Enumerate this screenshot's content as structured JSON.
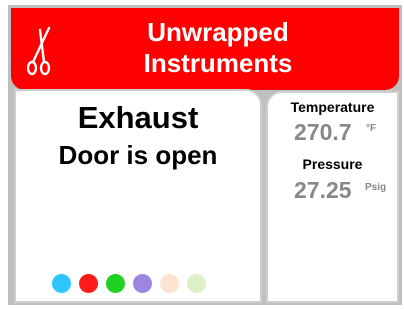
{
  "header": {
    "title_line1": "Unwrapped",
    "title_line2": "Instruments",
    "icon": "scissors-icon",
    "color": "#ff0000"
  },
  "status": {
    "line1": "Exhaust",
    "line2": "Door is open"
  },
  "indicators": [
    {
      "name": "cyan",
      "color": "#2ec4ff"
    },
    {
      "name": "red",
      "color": "#ff1a1a"
    },
    {
      "name": "green",
      "color": "#1fd21f"
    },
    {
      "name": "purple",
      "color": "#9d86df"
    },
    {
      "name": "peach",
      "color": "#fde3d2"
    },
    {
      "name": "light-green",
      "color": "#dcefc7"
    }
  ],
  "readings": {
    "temperature_label": "Temperature",
    "temperature_value": "270.7",
    "temperature_unit": "°F",
    "pressure_label": "Pressure",
    "pressure_value": "27.25",
    "pressure_unit": "Psig"
  }
}
